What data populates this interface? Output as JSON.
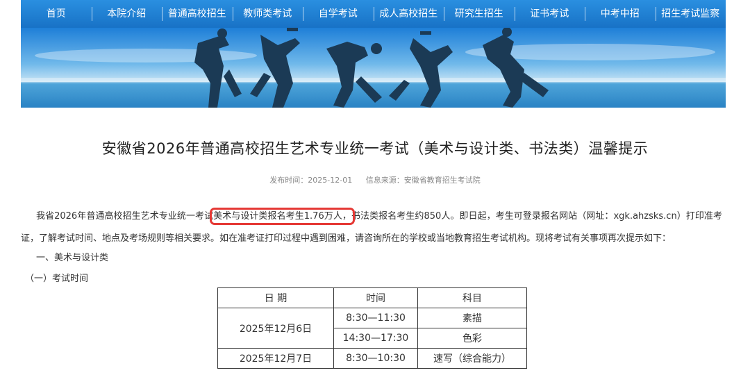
{
  "nav": {
    "items": [
      "首页",
      "本院介绍",
      "普通高校招生",
      "教师类考试",
      "自学考试",
      "成人高校招生",
      "研究生招生",
      "证书考试",
      "中考中招",
      "招生考试监察"
    ]
  },
  "article": {
    "title": "安徽省2026年普通高校招生艺术专业统一考试（美术与设计类、书法类）温馨提示",
    "publish_label": "发布时间：",
    "publish_date": "2025-12-01",
    "source_label": "信息来源：",
    "source": "安徽省教育招生考试院",
    "intro_before": "我省2026年普通高校招生艺术专业统一考试",
    "intro_highlight": "美术与设计类报名考生1.76万人，",
    "intro_after": "书法类报名考生约850人。即日起，考生可登录报名网站（网址：xgk.ahzsks.cn）打印准考证，了解考试时间、地点及考场规则等相关要求。如在准考证打印过程中遇到困难，请咨询所在的学校或当地教育招生考试机构。现将考试有关事项再次提示如下：",
    "section1": "一、美术与设计类",
    "section1_sub": "（一）考试时间"
  },
  "schedule": {
    "headers": [
      "日 期",
      "时间",
      "科目"
    ],
    "day1": "2025年12月6日",
    "day1_rows": [
      {
        "time": "8:30—11:30",
        "subject": "素描"
      },
      {
        "time": "14:30—17:30",
        "subject": "色彩"
      }
    ],
    "day2": "2025年12月7日",
    "day2_row": {
      "time": "8:30—10:30",
      "subject": "速写（综合能力）"
    }
  },
  "colors": {
    "nav_blue": "#1f7fd4",
    "highlight_border": "#e53935"
  }
}
